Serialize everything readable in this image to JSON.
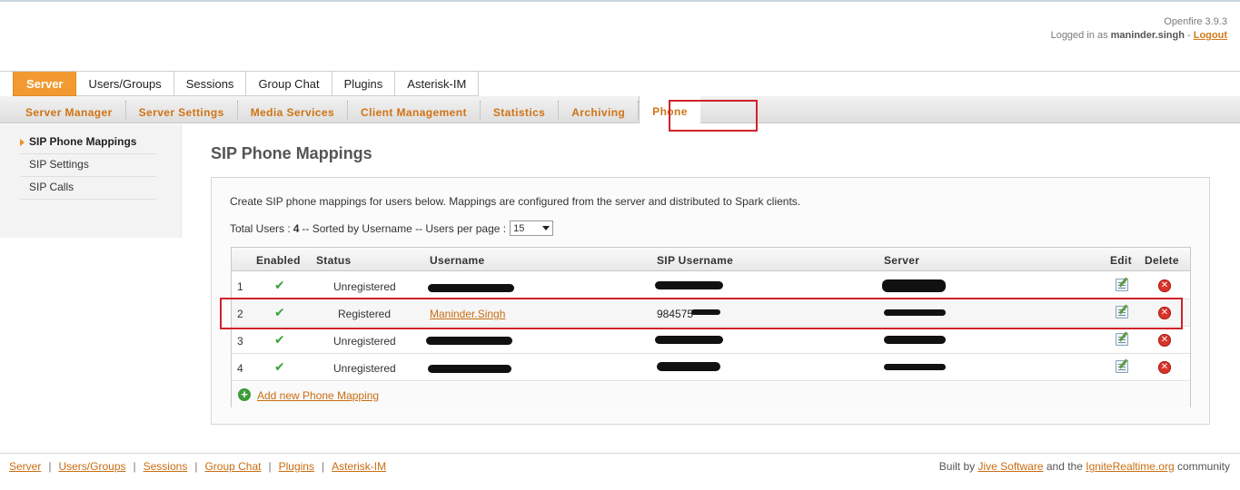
{
  "header": {
    "product": "Openfire 3.9.3",
    "logged_in_prefix": "Logged in as",
    "username": "maninder.singh",
    "separator": "-",
    "logout": "Logout"
  },
  "main_tabs": [
    "Server",
    "Users/Groups",
    "Sessions",
    "Group Chat",
    "Plugins",
    "Asterisk-IM"
  ],
  "sub_tabs": [
    "Server Manager",
    "Server Settings",
    "Media Services",
    "Client Management",
    "Statistics",
    "Archiving",
    "Phone"
  ],
  "sidebar": {
    "items": [
      "SIP Phone Mappings",
      "SIP Settings",
      "SIP Calls"
    ]
  },
  "page": {
    "title": "SIP Phone Mappings",
    "description": "Create SIP phone mappings for users below. Mappings are configured from the server and distributed to Spark clients.",
    "totals_prefix": "Total Users :",
    "total_users": "4",
    "totals_suffix": "-- Sorted by Username -- Users per page :",
    "per_page": "15"
  },
  "table": {
    "headers": [
      "Enabled",
      "Status",
      "Username",
      "SIP Username",
      "Server",
      "Edit",
      "Delete"
    ],
    "rows": [
      {
        "num": "1",
        "enabled": "✔",
        "status": "Unregistered",
        "username": "",
        "sip_username": "",
        "server": ""
      },
      {
        "num": "2",
        "enabled": "✔",
        "status": "Registered",
        "username": "Maninder.Singh",
        "sip_username": "984575",
        "server": ""
      },
      {
        "num": "3",
        "enabled": "✔",
        "status": "Unregistered",
        "username": "",
        "sip_username": "",
        "server": ""
      },
      {
        "num": "4",
        "enabled": "✔",
        "status": "Unregistered",
        "username": "",
        "sip_username": "",
        "server": ""
      }
    ],
    "add_label": "Add new Phone Mapping"
  },
  "footer": {
    "links": [
      "Server",
      "Users/Groups",
      "Sessions",
      "Group Chat",
      "Plugins",
      "Asterisk-IM"
    ],
    "separator": "|",
    "credit_prefix": "Built by",
    "credit_link1": "Jive Software",
    "credit_middle": "and the",
    "credit_link2": "IgniteRealtime.org",
    "credit_suffix": "community"
  },
  "colors": {
    "accent": "#f29a31",
    "link": "#c96d12",
    "highlight_box": "#d0222a",
    "check": "#3aa53a",
    "delete": "#d9342b"
  }
}
